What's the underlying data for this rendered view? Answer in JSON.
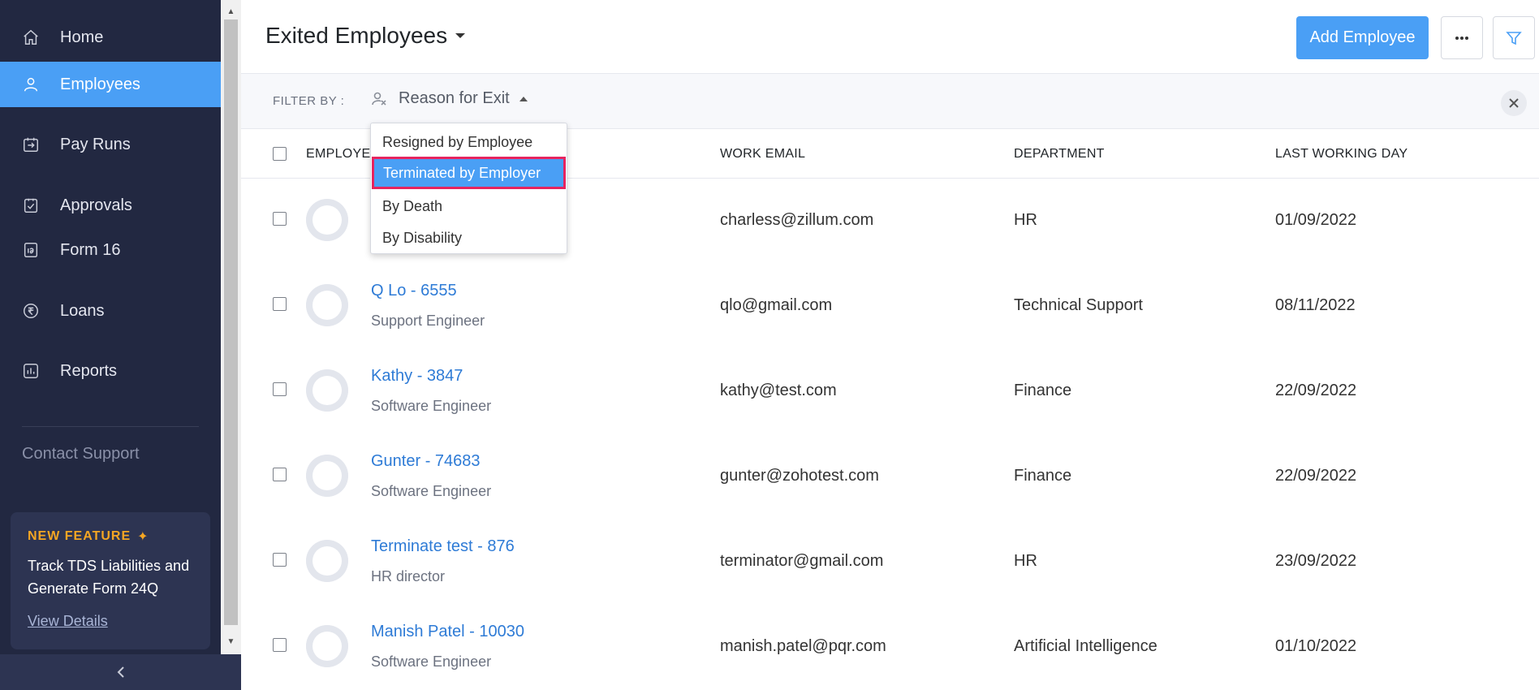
{
  "sidebar": {
    "items": [
      {
        "label": "Home",
        "icon": "home-icon"
      },
      {
        "label": "Employees",
        "icon": "user-icon",
        "active": true
      },
      {
        "label": "Pay Runs",
        "icon": "payrun-icon"
      },
      {
        "label": "Approvals",
        "icon": "approval-icon"
      },
      {
        "label": "Form 16",
        "icon": "form16-icon"
      },
      {
        "label": "Loans",
        "icon": "rupee-icon"
      },
      {
        "label": "Reports",
        "icon": "reports-icon"
      }
    ],
    "contact_support": "Contact Support",
    "feature": {
      "tag": "NEW FEATURE",
      "text": "Track TDS Liabilities and Generate Form 24Q",
      "link": "View Details"
    },
    "accent_color": "#4a9ff5"
  },
  "header": {
    "title": "Exited Employees",
    "add_button": "Add Employee"
  },
  "filter": {
    "label": "FILTER BY :",
    "chip": "Reason for Exit",
    "options": [
      "Resigned by Employee",
      "Terminated by Employer",
      "By Death",
      "By Disability"
    ],
    "selected": "Terminated by Employer"
  },
  "table": {
    "columns": [
      "EMPLOYEE NAME",
      "WORK EMAIL",
      "DEPARTMENT",
      "LAST WORKING DAY"
    ],
    "column_visible": [
      "EMPLOYEI",
      "WORK EMAIL",
      "DEPARTMENT",
      "LAST WORKING DAY"
    ],
    "rows": [
      {
        "name": "",
        "role": "",
        "email": "charless@zillum.com",
        "department": "HR",
        "last_day": "01/09/2022"
      },
      {
        "name": "Q Lo - 6555",
        "role": "Support Engineer",
        "email": "qlo@gmail.com",
        "department": "Technical Support",
        "last_day": "08/11/2022"
      },
      {
        "name": "Kathy - 3847",
        "role": "Software Engineer",
        "email": "kathy@test.com",
        "department": "Finance",
        "last_day": "22/09/2022"
      },
      {
        "name": "Gunter - 74683",
        "role": "Software Engineer",
        "email": "gunter@zohotest.com",
        "department": "Finance",
        "last_day": "22/09/2022"
      },
      {
        "name": "Terminate test - 876",
        "role": "HR director",
        "email": "terminator@gmail.com",
        "department": "HR",
        "last_day": "23/09/2022"
      },
      {
        "name": "Manish Patel - 10030",
        "role": "Software Engineer",
        "email": "manish.patel@pqr.com",
        "department": "Artificial Intelligence",
        "last_day": "01/10/2022"
      }
    ]
  }
}
